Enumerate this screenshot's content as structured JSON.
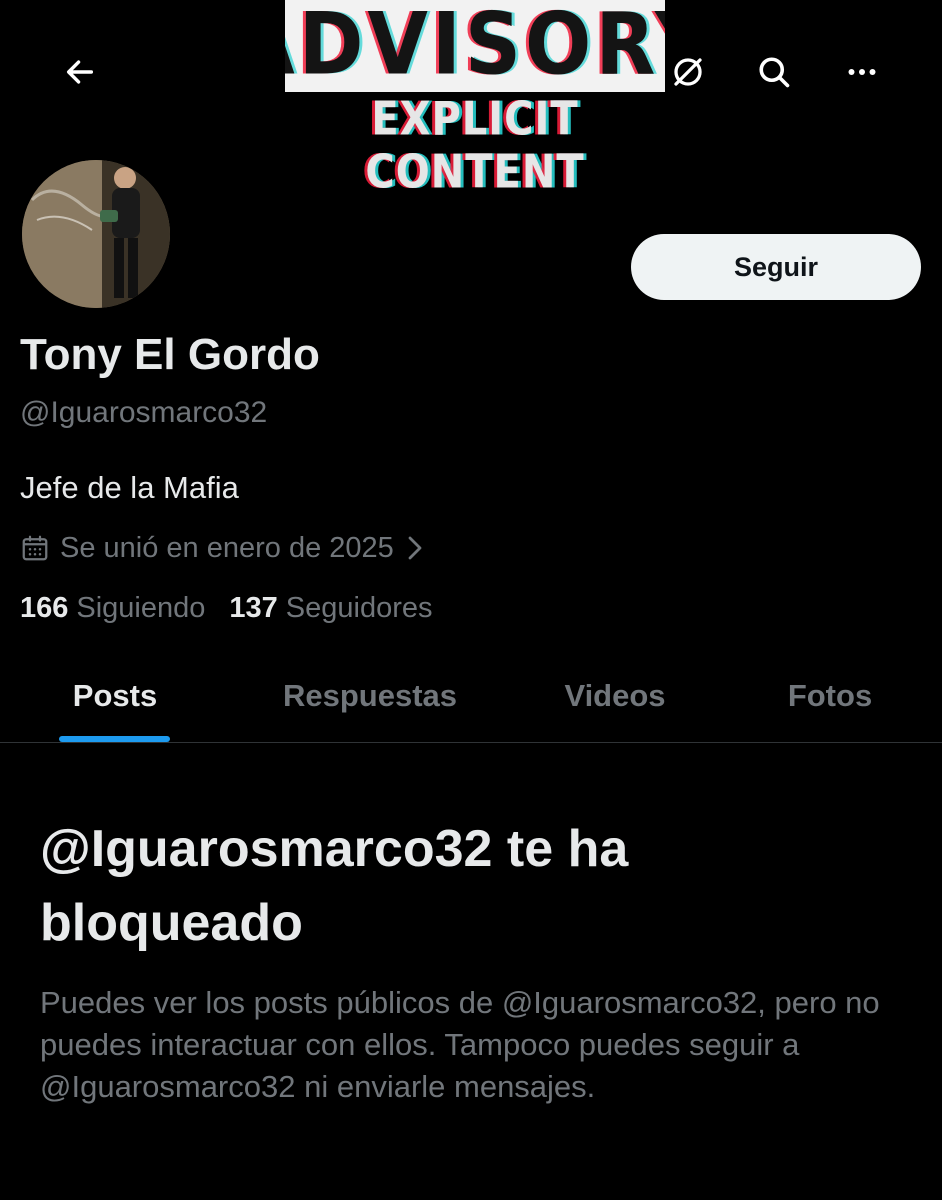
{
  "banner": {
    "advisory_text": "ADVISORY",
    "explicit_text": "EXPLICIT CONTENT"
  },
  "toolbar": {
    "back_icon": "arrow-left-icon",
    "grok_icon": "grok-icon",
    "search_icon": "search-icon",
    "more_icon": "more-horizontal-icon"
  },
  "profile": {
    "follow_label": "Seguir",
    "display_name": "Tony El Gordo",
    "handle": "@Iguarosmarco32",
    "bio": "Jefe de la Mafia",
    "joined": "Se unió en enero de 2025",
    "following_count": "166",
    "following_label": "Siguiendo",
    "followers_count": "137",
    "followers_label": "Seguidores"
  },
  "tabs": [
    {
      "label": "Posts",
      "active": true
    },
    {
      "label": "Respuestas",
      "active": false
    },
    {
      "label": "Videos",
      "active": false
    },
    {
      "label": "Fotos",
      "active": false
    }
  ],
  "blocked": {
    "title": "@Iguarosmarco32 te ha bloqueado",
    "body": "Puedes ver los posts públicos de @Iguarosmarco32, pero no puedes interactuar con ellos. Tampoco puedes seguir a @Iguarosmarco32 ni enviarle mensajes."
  },
  "colors": {
    "background": "#000000",
    "primary_text": "#e7e9ea",
    "secondary_text": "#71767b",
    "accent": "#1d9bf0",
    "follow_button_bg": "#eff3f4"
  }
}
